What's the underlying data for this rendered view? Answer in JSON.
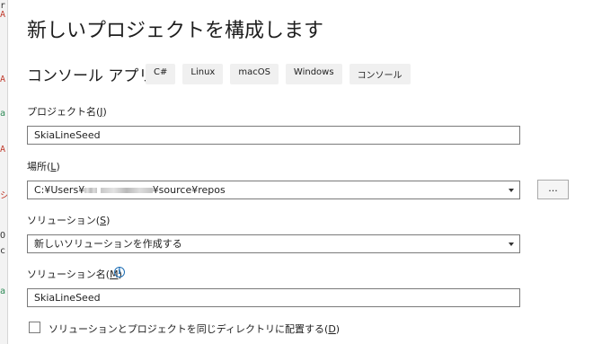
{
  "title": "新しいプロジェクトを構成します",
  "template": {
    "name": "コンソール アプリ",
    "tags": [
      "C#",
      "Linux",
      "macOS",
      "Windows",
      "コンソール"
    ]
  },
  "project_name": {
    "label": "プロジェクト名",
    "mnemonic": "J",
    "value": "SkiaLineSeed"
  },
  "location": {
    "label": "場所",
    "mnemonic": "L",
    "value_prefix": "C:¥Users¥",
    "value_suffix": "¥source¥repos",
    "browse_label": "..."
  },
  "solution": {
    "label": "ソリューション",
    "mnemonic": "S",
    "value": "新しいソリューションを作成する"
  },
  "solution_name": {
    "label": "ソリューション名",
    "mnemonic": "M",
    "value": "SkiaLineSeed"
  },
  "same_dir": {
    "label": "ソリューションとプロジェクトを同じディレクトリに配置する",
    "mnemonic": "D",
    "checked": false
  },
  "colors": {
    "accent": "#1f6fb5",
    "field_border": "#7a7a7a",
    "tag_bg": "#f0f0f0"
  }
}
